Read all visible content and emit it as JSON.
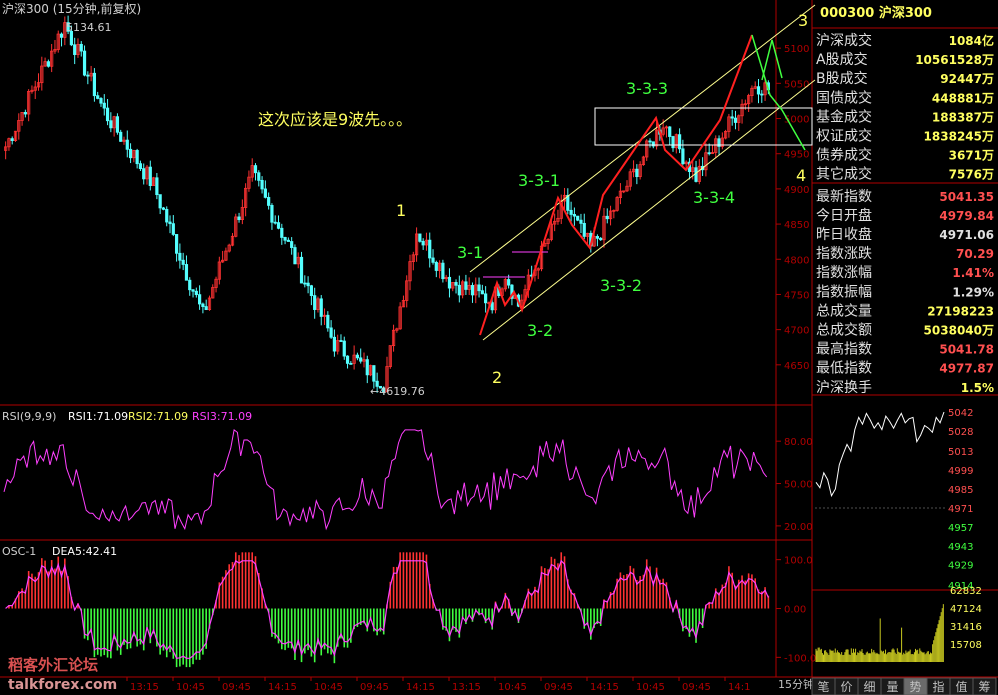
{
  "header": {
    "title": "沪深300 (15分钟,前复权)",
    "code_title": "000300 沪深300"
  },
  "annotations": {
    "high_label": "5134.61",
    "low_label": "←4619.76",
    "comment": "这次应该是9波先。。。",
    "waves": [
      {
        "text": "1",
        "color": "#ffff60"
      },
      {
        "text": "2",
        "color": "#ffff60"
      },
      {
        "text": "3",
        "color": "#ffff60"
      },
      {
        "text": "4",
        "color": "#ffff60"
      },
      {
        "text": "3-1",
        "color": "#40ff40"
      },
      {
        "text": "3-2",
        "color": "#40ff40"
      },
      {
        "text": "3-3-1",
        "color": "#40ff40"
      },
      {
        "text": "3-3-2",
        "color": "#40ff40"
      },
      {
        "text": "3-3-3",
        "color": "#40ff40"
      },
      {
        "text": "3-3-4",
        "color": "#40ff40"
      }
    ]
  },
  "stats": [
    {
      "label": "沪深成交",
      "value": "1084亿",
      "color": "#ffff60"
    },
    {
      "label": "A股成交",
      "value": "10561528万",
      "color": "#ffff60"
    },
    {
      "label": "B股成交",
      "value": "92447万",
      "color": "#ffff60"
    },
    {
      "label": "国债成交",
      "value": "448881万",
      "color": "#ffff60"
    },
    {
      "label": "基金成交",
      "value": "188387万",
      "color": "#ffff60"
    },
    {
      "label": "权证成交",
      "value": "1838245万",
      "color": "#ffff60"
    },
    {
      "label": "债券成交",
      "value": "3671万",
      "color": "#ffff60"
    },
    {
      "label": "其它成交",
      "value": "7576万",
      "color": "#ffff60"
    },
    {
      "label": "最新指数",
      "value": "5041.35",
      "color": "#ff5050"
    },
    {
      "label": "今日开盘",
      "value": "4979.84",
      "color": "#ff5050"
    },
    {
      "label": "昨日收盘",
      "value": "4971.06",
      "color": "#e0e0e0"
    },
    {
      "label": "指数涨跌",
      "value": "70.29",
      "color": "#ff5050"
    },
    {
      "label": "指数涨幅",
      "value": "1.41%",
      "color": "#ff5050"
    },
    {
      "label": "指数振幅",
      "value": "1.29%",
      "color": "#e0e0e0"
    },
    {
      "label": "总成交量",
      "value": "27198223",
      "color": "#ffff60"
    },
    {
      "label": "总成交额",
      "value": "5038040万",
      "color": "#ffff60"
    },
    {
      "label": "最高指数",
      "value": "5041.78",
      "color": "#ff5050"
    },
    {
      "label": "最低指数",
      "value": "4977.87",
      "color": "#ff5050"
    },
    {
      "label": "沪深换手",
      "value": "1.5%",
      "color": "#ffff60"
    }
  ],
  "rsi_panel": {
    "title": "RSI(9,9,9)",
    "rsi1": "RSI1:71.09",
    "rsi2": "RSI2:71.09",
    "rsi3": "RSI3:71.09",
    "ticks": [
      "80.00",
      "50.00",
      "20.00"
    ]
  },
  "osc_panel": {
    "title": "OSC-1",
    "dea": "DEA5:42.41",
    "ticks": [
      "100.0",
      "0.00",
      "-100.0"
    ]
  },
  "time_axis": {
    "labels": [
      "13:15",
      "10:45",
      "09:45",
      "14:15",
      "10:45",
      "09:45",
      "14:15",
      "13:15",
      "10:45",
      "09:45",
      "14:15",
      "10:45",
      "09:45",
      "14:1"
    ],
    "period_label": "15分钟"
  },
  "intraday_axis": {
    "price_ticks": [
      "5042",
      "5028",
      "5013",
      "4999",
      "4985",
      "4971",
      "4957",
      "4943",
      "4929",
      "4914"
    ],
    "volume_ticks": [
      "62832",
      "47124",
      "31416",
      "15708"
    ]
  },
  "bottom_tabs": [
    "笔",
    "价",
    "细",
    "量",
    "势",
    "指",
    "值",
    "筹"
  ],
  "active_tab": "势",
  "watermark": {
    "chinese": "稻客外汇论坛",
    "site": "talkforex.com"
  },
  "colors": {
    "up": "#ff3232",
    "down": "#54ffff",
    "axis": "#b00000",
    "rsi": "#ff40ff",
    "osc_pos": "#ff3232",
    "osc_neg": "#40ff40",
    "dea": "#ff40ff"
  },
  "chart_data": [
    {
      "type": "candlestick",
      "title": "沪深300 (15分钟,前复权)",
      "y_ticks": [
        5100,
        5050,
        5000,
        4950,
        4900,
        4850,
        4800,
        4750,
        4700,
        4650
      ],
      "ylim": [
        4600,
        5140
      ],
      "x_labels": [
        "13:15",
        "10:45",
        "09:45",
        "14:15",
        "10:45",
        "09:45",
        "14:15",
        "13:15",
        "10:45",
        "09:45",
        "14:15",
        "10:45",
        "09:45",
        "14:1"
      ],
      "waypoints": [
        {
          "i": 0,
          "close": 4960
        },
        {
          "i": 18,
          "close": 5134.61
        },
        {
          "i": 30,
          "close": 5010
        },
        {
          "i": 45,
          "close": 4905
        },
        {
          "i": 60,
          "close": 4720
        },
        {
          "i": 75,
          "close": 4920
        },
        {
          "i": 85,
          "close": 4830
        },
        {
          "i": 100,
          "close": 4680
        },
        {
          "i": 115,
          "close": 4625
        },
        {
          "i": 125,
          "close": 4840
        },
        {
          "i": 135,
          "close": 4770
        },
        {
          "i": 148,
          "close": 4740
        },
        {
          "i": 152,
          "close": 4780
        },
        {
          "i": 156,
          "close": 4735
        },
        {
          "i": 170,
          "close": 4880
        },
        {
          "i": 178,
          "close": 4815
        },
        {
          "i": 192,
          "close": 4930
        },
        {
          "i": 200,
          "close": 4995
        },
        {
          "i": 210,
          "close": 4918
        },
        {
          "i": 228,
          "close": 5050
        },
        {
          "i": 232,
          "close": 5042
        }
      ],
      "high": 5134.61,
      "low": 4619.76
    },
    {
      "type": "line",
      "title": "RSI(9,9,9)",
      "series": [
        {
          "name": "RSI1",
          "last": 71.09
        },
        {
          "name": "RSI2",
          "last": 71.09
        },
        {
          "name": "RSI3",
          "last": 71.09
        }
      ],
      "y_ticks": [
        80,
        50,
        20
      ],
      "ylim": [
        10,
        95
      ]
    },
    {
      "type": "bar",
      "title": "OSC-1",
      "series": [
        {
          "name": "DEA5",
          "last": 42.41
        }
      ],
      "y_ticks": [
        100,
        0,
        -100
      ],
      "ylim": [
        -130,
        130
      ]
    },
    {
      "type": "line",
      "y_ticks": [
        5042,
        5028,
        5013,
        4999,
        4985,
        4971,
        4957,
        4943,
        4929,
        4914
      ],
      "ylim": [
        4914,
        5042
      ]
    },
    {
      "type": "bar",
      "y_ticks": [
        62832,
        47124,
        31416,
        15708
      ],
      "ylim": [
        0,
        62832
      ]
    }
  ]
}
